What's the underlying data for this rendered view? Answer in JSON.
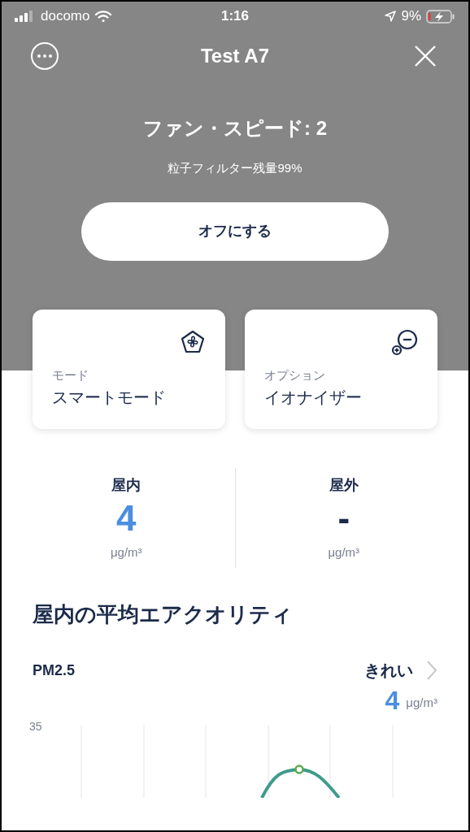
{
  "status_bar": {
    "carrier": "docomo",
    "time": "1:16",
    "battery": "9%"
  },
  "header": {
    "title": "Test A7"
  },
  "fan": {
    "speed": "ファン・スピード: 2",
    "filter": "粒子フィルター残量99%",
    "button": "オフにする"
  },
  "cards": [
    {
      "kind": "fan",
      "label": "モード",
      "value": "スマートモード"
    },
    {
      "kind": "ion",
      "label": "オプション",
      "value": "イオナイザー"
    }
  ],
  "readings": [
    {
      "label": "屋内",
      "value": "4",
      "unit": "μg/m³",
      "color": "#4a8fe0"
    },
    {
      "label": "屋外",
      "value": "-",
      "unit": "μg/m³",
      "color": "#1b2a4a"
    }
  ],
  "section": {
    "title": "屋内の平均エアクオリティ",
    "metric": "PM2.5",
    "status": "きれい",
    "value": "4",
    "unit": "μg/m³",
    "chart_tick": "35"
  }
}
